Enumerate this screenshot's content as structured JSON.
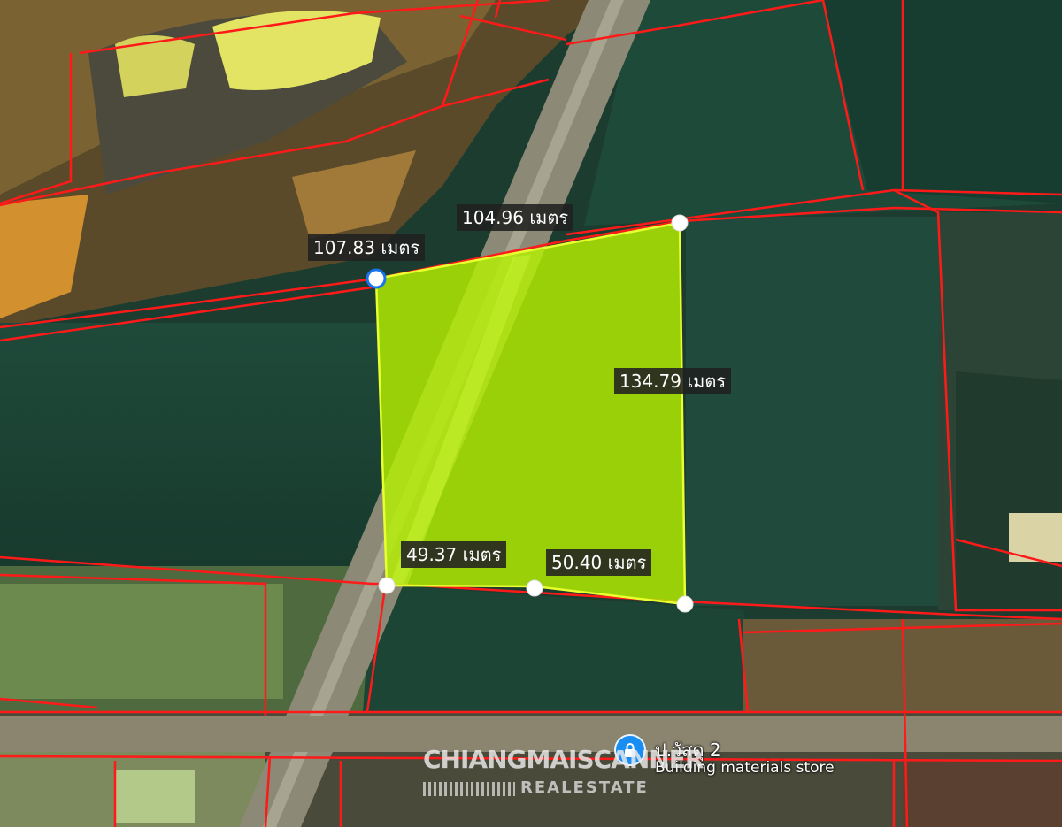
{
  "measurements": {
    "top_left_edge": "107.83 เมตร",
    "top_right_edge": "104.96 เมตร",
    "right_edge": "134.79 เมตร",
    "bottom_left_edge": "49.37 เมตร",
    "bottom_right_edge": "50.40 เมตร"
  },
  "poi": {
    "icon": "lock-icon",
    "name": "ป.วัสดุ 2",
    "category": "Building materials store"
  },
  "watermark": {
    "main": "CHIANGMAISCANNER",
    "sub": "REALESTATE"
  },
  "colors": {
    "parcel_fill": "#b6f000",
    "boundary_lines": "#ff1a1a",
    "label_background": "#202020",
    "poi_pin": "#1a8df2"
  }
}
